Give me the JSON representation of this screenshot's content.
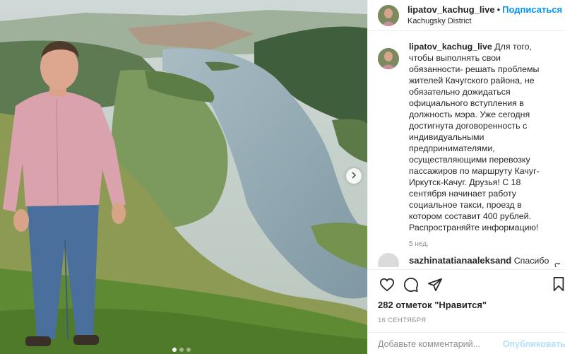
{
  "post": {
    "username": "lipatov_kachug_live",
    "follow_label": "Подписаться",
    "location": "Kachugsky District",
    "caption_username": "lipatov_kachug_live",
    "caption_text": "Для того, чтобы выполнять свои обязанности- решать проблемы жителей Качугского района, не обязательно дожидаться официального вступления в должность мэра. Уже сегодня достигнута договоренность с индивидуальными предпринимателями, осуществляющими перевозку пассажиров по маршруту Качуг- Иркутск-Качуг. Друзья! С 18 сентября начинает работу социальное такси, проезд в котором составит 400 рублей. Распространяйте информацию!",
    "caption_time": "5 нед.",
    "comments": [
      {
        "username": "sazhinatatianaaleksand",
        "text": "Спасибо"
      }
    ],
    "likes_text": "282 отметок \"Нравится\"",
    "date": "16 СЕНТЯБРЯ",
    "comment_placeholder": "Добавьте комментарий...",
    "publish_label": "Опубликовать",
    "carousel": {
      "slides": 3,
      "active": 1
    }
  },
  "icons": {
    "like": "heart-icon",
    "comment": "comment-icon",
    "share": "share-icon",
    "save": "bookmark-icon",
    "next": "chevron-right-icon"
  },
  "colors": {
    "accent": "#0095f6",
    "text": "#262626",
    "muted": "#8e8e8e",
    "publish_disabled": "#b2dffc"
  }
}
